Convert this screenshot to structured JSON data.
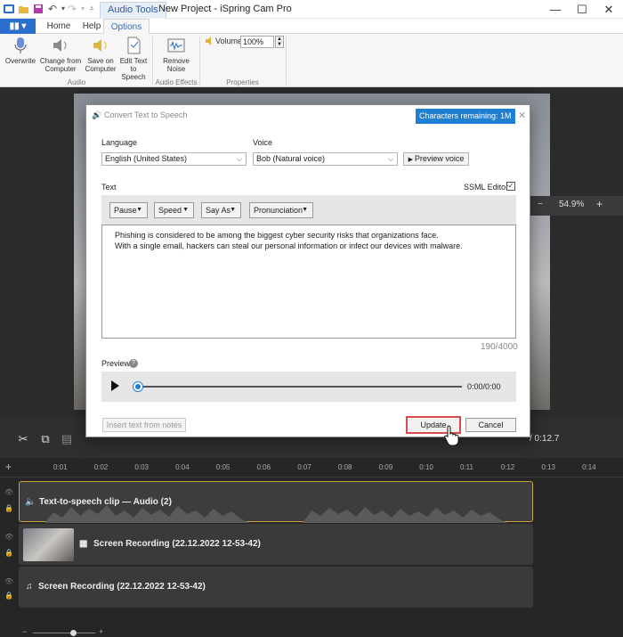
{
  "titlebar": {
    "context_tab": "Audio Tools",
    "window_title": "New Project - iSpring Cam Pro"
  },
  "ribbon_tabs": {
    "file": "",
    "home": "Home",
    "help": "Help",
    "options": "Options"
  },
  "ribbon": {
    "overwrite": "Overwrite",
    "change_from_computer": [
      "Change from",
      "Computer"
    ],
    "save_on_computer": [
      "Save on",
      "Computer"
    ],
    "edit_text_to_speech": [
      "Edit Text",
      "to Speech"
    ],
    "remove_noise": [
      "Remove",
      "Noise"
    ],
    "volume_label": "Volume",
    "volume_value": "100%",
    "group_audio": "Audio",
    "group_audio_effects": "Audio Effects",
    "group_properties": "Properties"
  },
  "canvas": {
    "zoom_minus": "−",
    "zoom_value": "54.9%",
    "zoom_plus": "+"
  },
  "dialog": {
    "title": "Convert Text to Speech",
    "chars_remaining": "Characters remaining: 1M",
    "language_label": "Language",
    "language_value": "English (United States)",
    "voice_label": "Voice",
    "voice_value": "Bob (Natural voice)",
    "preview_voice": "Preview voice",
    "text_label": "Text",
    "ssml_label": "SSML Editor",
    "ssml_checked": true,
    "toolbar": {
      "pause": "Pause",
      "speed": "Speed",
      "say_as": "Say As",
      "pronunciation": "Pronunciation"
    },
    "text_lines": [
      "Phishing is considered to be among the biggest cyber security risks that organizations face.",
      "With a single email, hackers can steal our personal information or infect our devices with malware."
    ],
    "char_count": "190/4000",
    "preview_label": "Preview",
    "player_time": "0:00/0:00",
    "insert_from_notes": "Insert text from notes",
    "update": "Update",
    "cancel": "Cancel"
  },
  "timeline": {
    "time_display": "/ 0:12.7",
    "ruler_ticks": [
      "0:01",
      "0:02",
      "0:03",
      "0:04",
      "0:05",
      "0:06",
      "0:07",
      "0:08",
      "0:09",
      "0:10",
      "0:11",
      "0:12",
      "0:13",
      "0:14"
    ],
    "track_tts": "Text-to-speech clip — Audio (2)",
    "track_screen": "Screen Recording (22.12.2022 12-53-42)",
    "track_audio": "Screen Recording (22.12.2022 12-53-42)",
    "selected_color": "#c9a43a"
  },
  "colors": {
    "accent": "#1f7fd3",
    "file_button": "#2b6fce",
    "update_border": "#d94b4b"
  }
}
